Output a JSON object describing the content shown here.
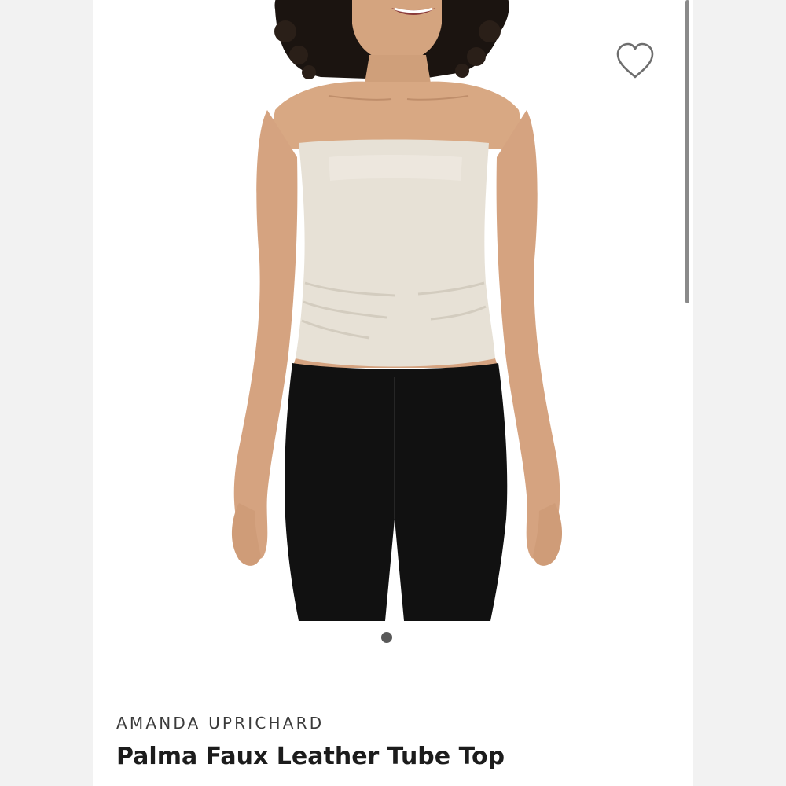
{
  "product": {
    "brand": "AMANDA UPRICHARD",
    "title": "Palma Faux Leather Tube Top",
    "image_alt": "Model wearing cream strapless faux leather tube top with black pants"
  },
  "gallery": {
    "image_count": 1,
    "active_index": 0
  },
  "icons": {
    "favorite": "heart-outline-icon"
  },
  "colors": {
    "card_background": "#ffffff",
    "page_background": "#f4f4f4",
    "top_color": "#e7e1d6",
    "pants_color": "#111111",
    "skin_tone": "#d8a883",
    "hair_color": "#1b1410",
    "text_primary": "#1c1c1c",
    "text_secondary": "#3a3a3a"
  }
}
